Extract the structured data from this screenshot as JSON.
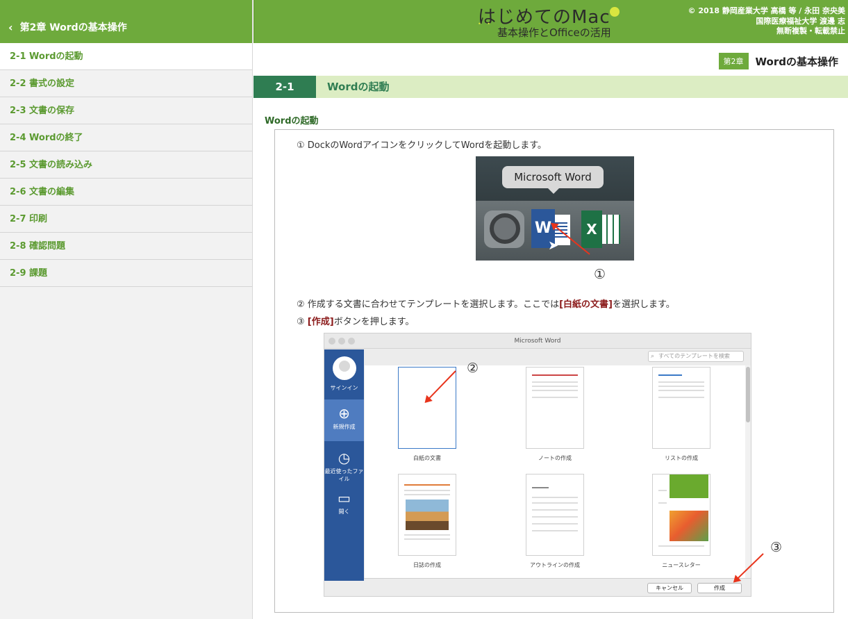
{
  "sidebar": {
    "header": "第2章 Wordの基本操作",
    "items": [
      {
        "label": "2-1 Wordの起動"
      },
      {
        "label": "2-2 書式の設定"
      },
      {
        "label": "2-3 文書の保存"
      },
      {
        "label": "2-4 Wordの終了"
      },
      {
        "label": "2-5 文書の読み込み"
      },
      {
        "label": "2-6 文書の編集"
      },
      {
        "label": "2-7 印刷"
      },
      {
        "label": "2-8 確認問題"
      },
      {
        "label": "2-9 課題"
      }
    ]
  },
  "header": {
    "logo_main": "はじめてのMac",
    "logo_sub": "基本操作とOfficeの活用",
    "copyright": [
      "© 2018 静岡産業大学 高橋 等 / 永田 奈央美",
      "国際医療福祉大学 渡邊 志",
      "無断複製・転載禁止"
    ]
  },
  "content": {
    "chapter_badge": "第2章",
    "chapter_title": "Wordの基本操作",
    "section_number": "2-1",
    "section_title": "Wordの起動",
    "sub_heading": "Wordの起動",
    "step1": "① DockのWordアイコンをクリックしてWordを起動します。",
    "step2_pre": "② 作成する文書に合わせてテンプレートを選択します。ここでは",
    "step2_hl": "[白紙の文書]",
    "step2_post": "を選択します。",
    "step3_pre": "③ ",
    "step3_hl": "[作成]",
    "step3_post": "ボタンを押します。",
    "markers": [
      "①",
      "②",
      "③"
    ]
  },
  "dock": {
    "tooltip": "Microsoft Word",
    "word_letter": "W",
    "excel_letter": "X"
  },
  "word_window": {
    "title": "Microsoft Word",
    "search_placeholder": "すべてのテンプレートを検索",
    "side": [
      {
        "label": "サインイン",
        "icon": "user-icon"
      },
      {
        "label": "新規作成",
        "icon": "new-document-icon"
      },
      {
        "label": "最近使ったファイル",
        "icon": "clock-icon"
      },
      {
        "label": "開く",
        "icon": "folder-icon"
      }
    ],
    "templates": [
      {
        "caption": "白紙の文書"
      },
      {
        "caption": "ノートの作成"
      },
      {
        "caption": "リストの作成"
      },
      {
        "caption": "日誌の作成"
      },
      {
        "caption": "アウトラインの作成"
      },
      {
        "caption": "ニュースレター"
      }
    ],
    "cancel_label": "キャンセル",
    "create_label": "作成"
  },
  "colors": {
    "brand_green": "#6eaa3c",
    "section_dark_green": "#2f7d52",
    "highlight_red": "#8b1a1a",
    "arrow_red": "#e8341c",
    "word_blue": "#2b579a"
  }
}
